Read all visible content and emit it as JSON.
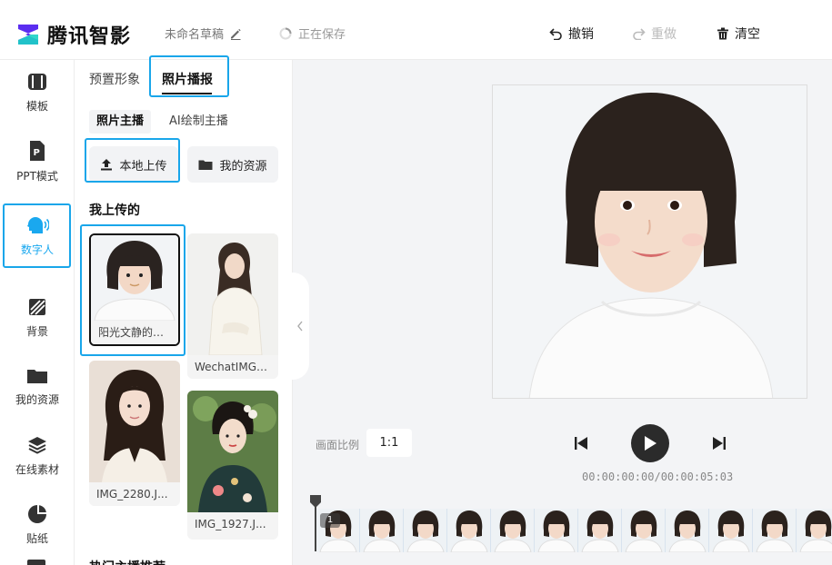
{
  "header": {
    "brand": "腾讯智影",
    "draft_title": "未命名草稿",
    "saving_status": "正在保存",
    "undo": "撤销",
    "redo": "重做",
    "clear": "清空"
  },
  "nav": {
    "items": [
      {
        "label": "模板",
        "icon": "template-icon"
      },
      {
        "label": "PPT模式",
        "icon": "ppt-icon"
      },
      {
        "label": "数字人",
        "icon": "digital-human-icon",
        "active": true
      },
      {
        "label": "背景",
        "icon": "background-icon"
      },
      {
        "label": "我的资源",
        "icon": "folder-icon"
      },
      {
        "label": "在线素材",
        "icon": "layers-icon"
      },
      {
        "label": "贴纸",
        "icon": "sticker-icon"
      }
    ]
  },
  "panel": {
    "tabs": [
      "预置形象",
      "照片播报"
    ],
    "active_tab": "照片播报",
    "subtabs": [
      "照片主播",
      "AI绘制主播"
    ],
    "upload_label": "本地上传",
    "resources_label": "我的资源",
    "section_uploaded": "我上传的",
    "section_hot": "热门主播推荐",
    "uploads": [
      {
        "caption": "阳光文静的小..."
      },
      {
        "caption": "WechatIMG3..."
      },
      {
        "caption": "IMG_2280.J..."
      },
      {
        "caption": "IMG_1927.J..."
      }
    ]
  },
  "player": {
    "ratio_label": "画面比例",
    "ratio_value": "1:1",
    "timecode": "00:00:00:00/00:00:05:03",
    "track_number": "1"
  },
  "colors": {
    "accent": "#19a6ea",
    "dark_button": "#2b2b2b"
  }
}
